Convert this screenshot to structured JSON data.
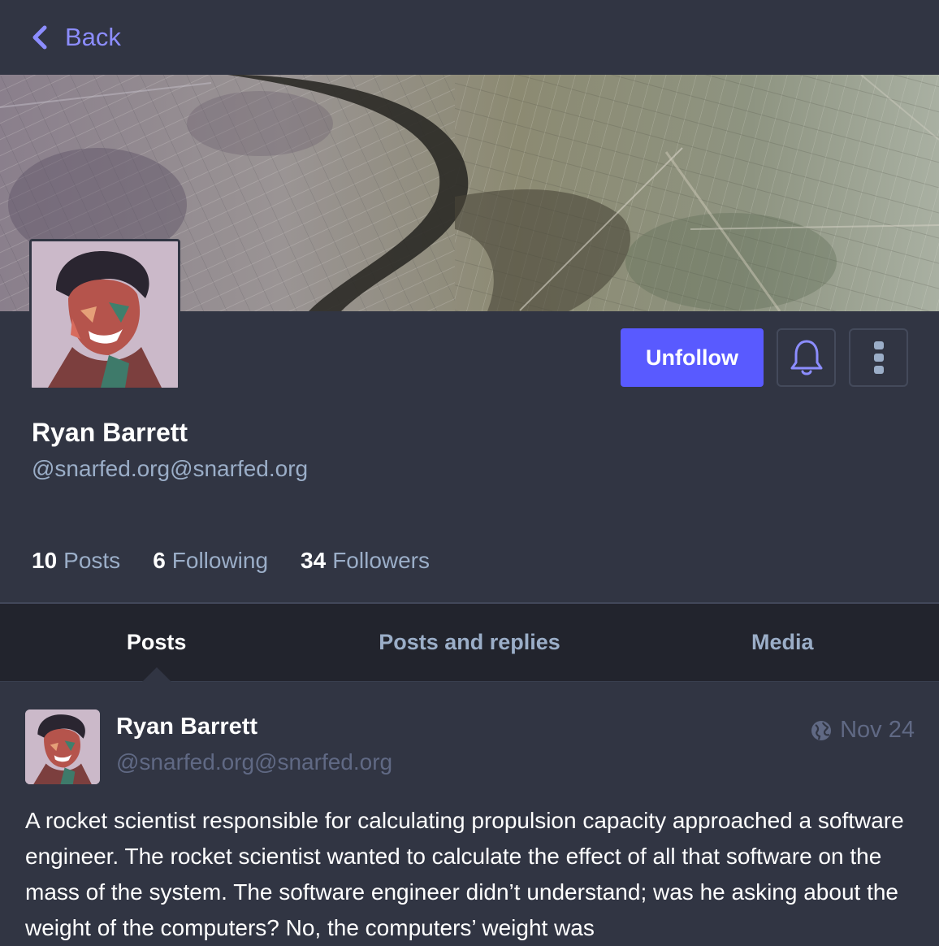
{
  "nav": {
    "back_label": "Back"
  },
  "profile": {
    "display_name": "Ryan Barrett",
    "handle": "@snarfed.org@snarfed.org",
    "actions": {
      "unfollow_label": "Unfollow"
    },
    "stats": [
      {
        "count": "10",
        "label": "Posts"
      },
      {
        "count": "6",
        "label": "Following"
      },
      {
        "count": "34",
        "label": "Followers"
      }
    ]
  },
  "tabs": [
    {
      "label": "Posts",
      "active": true
    },
    {
      "label": "Posts and replies",
      "active": false
    },
    {
      "label": "Media",
      "active": false
    }
  ],
  "post": {
    "author_name": "Ryan Barrett",
    "author_handle": "@snarfed.org@snarfed.org",
    "date": "Nov 24",
    "visibility_icon": "globe-icon",
    "content": "A rocket scientist responsible for calculating propulsion capacity approached a software engineer. The rocket scientist wanted to calculate the effect of all that software on the mass of the system. The software engineer didn’t understand; was he asking about the weight of the computers? No, the computers’ weight was"
  },
  "colors": {
    "background": "#313543",
    "tabs_background": "#22242d",
    "accent": "#595aff",
    "link": "#8c8dff",
    "secondary_text": "#9baec8",
    "muted_text": "#606984"
  }
}
